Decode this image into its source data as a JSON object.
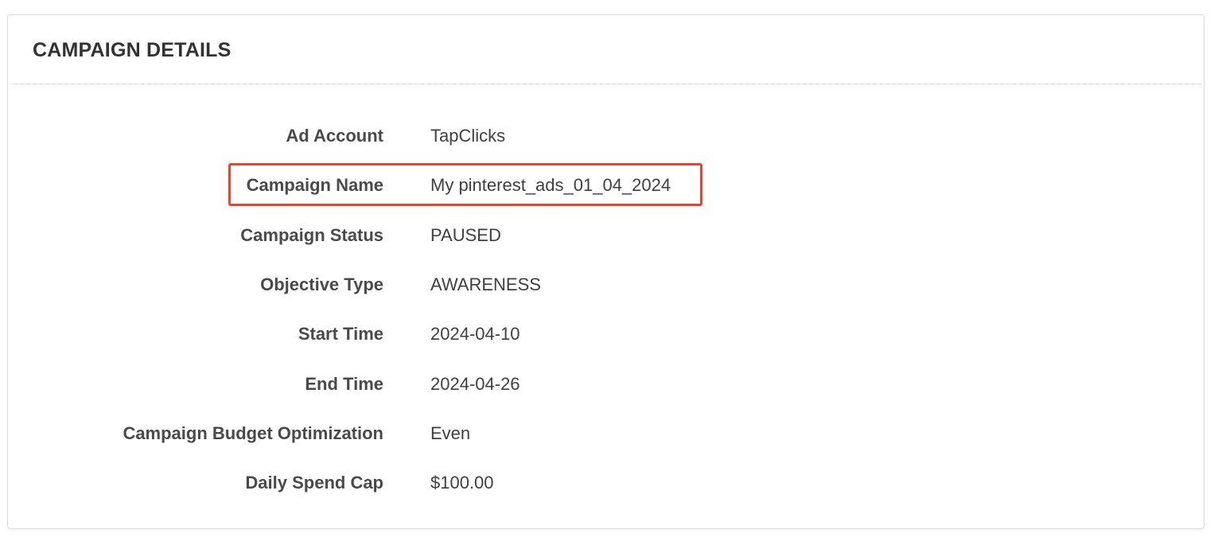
{
  "panel": {
    "title": "CAMPAIGN DETAILS"
  },
  "details": [
    {
      "label": "Ad Account",
      "value": "TapClicks"
    },
    {
      "label": "Campaign Name",
      "value": "My pinterest_ads_01_04_2024"
    },
    {
      "label": "Campaign Status",
      "value": "PAUSED"
    },
    {
      "label": "Objective Type",
      "value": "AWARENESS"
    },
    {
      "label": "Start Time",
      "value": "2024-04-10"
    },
    {
      "label": "End Time",
      "value": "2024-04-26"
    },
    {
      "label": "Campaign Budget Optimization",
      "value": "Even"
    },
    {
      "label": "Daily Spend Cap",
      "value": "$100.00"
    }
  ],
  "highlight": {
    "row": "Campaign Name",
    "color": "#e8462a"
  }
}
